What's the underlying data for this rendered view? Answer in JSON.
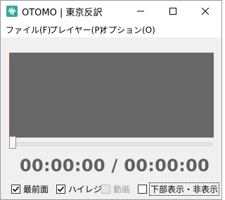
{
  "window": {
    "title": "OTOMO | 東京反訳",
    "app_icon": "waveform-icon",
    "controls": [
      "minimize-icon",
      "maximize-icon",
      "close-icon"
    ]
  },
  "menu": [
    {
      "label": "ファイル(F)"
    },
    {
      "label": "プレイヤー(P)"
    },
    {
      "label": "オプション(O)"
    }
  ],
  "player": {
    "seek_position": 0,
    "time_display": "00:00:00 / 00:00:00"
  },
  "options": [
    {
      "label": "最前面",
      "checked": true,
      "enabled": true
    },
    {
      "label": "ハイレジ",
      "checked": true,
      "enabled": true
    },
    {
      "label": "動画",
      "checked": false,
      "enabled": false
    },
    {
      "label": "下部表示・非表示",
      "checked": false,
      "enabled": true,
      "focused": true
    }
  ],
  "colors": {
    "video_bg": "#676767",
    "time_text": "#606060",
    "app_icon": "#2fa896"
  }
}
